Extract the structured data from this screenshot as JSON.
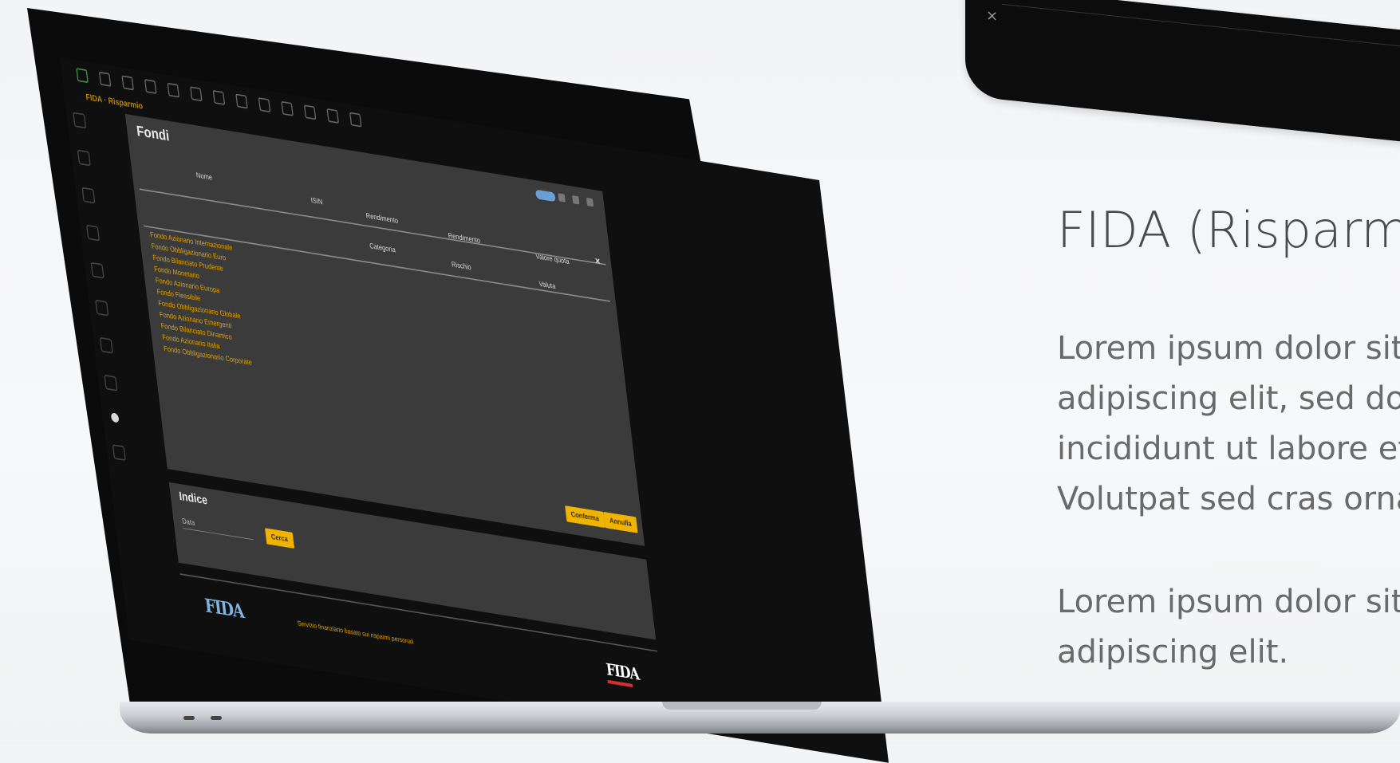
{
  "app": {
    "title": "FIDA · Risparmio",
    "panel_title": "Fondi",
    "column_headers": [
      "Nome",
      "ISIN",
      "Rendimento",
      "Rendimento",
      "Valore quota"
    ],
    "sub_headers": [
      "Categoria",
      "Rischio",
      "Valuta"
    ],
    "row_labels": [
      "Fondo Azionario Internazionale",
      "Fondo Obbligazionario Euro",
      "Fondo Bilanciato Prudente",
      "Fondo Monetario",
      "Fondo Azionario Europa",
      "Fondo Flessibile",
      "Fondo Obbligazionario Globale",
      "Fondo Azionario Emergenti",
      "Fondo Bilanciato Dinamico",
      "Fondo Azionario Italia",
      "Fondo Obbligazionario Corporate"
    ],
    "buttons": {
      "confirm": "Conferma",
      "cancel": "Annulla",
      "search": "Cerca"
    },
    "panel2_title": "Indice",
    "panel2_field": "Data",
    "footer_text": "Servizio finanziario basato sui risparmi personali"
  },
  "logos": {
    "left": "FIDA",
    "right": "FIDA"
  },
  "slide": {
    "title": "FIDA (Risparmio",
    "paragraph1": [
      "Lorem ipsum dolor sit amet, consectetur",
      "adipiscing elit, sed do eiusmod tempor",
      "incididunt ut labore et dolore magna aliqua.",
      "Volutpat sed cras ornare arcu dui."
    ],
    "paragraph2": [
      "Lorem ipsum dolor sit amet, consectetur",
      "adipiscing elit."
    ]
  }
}
